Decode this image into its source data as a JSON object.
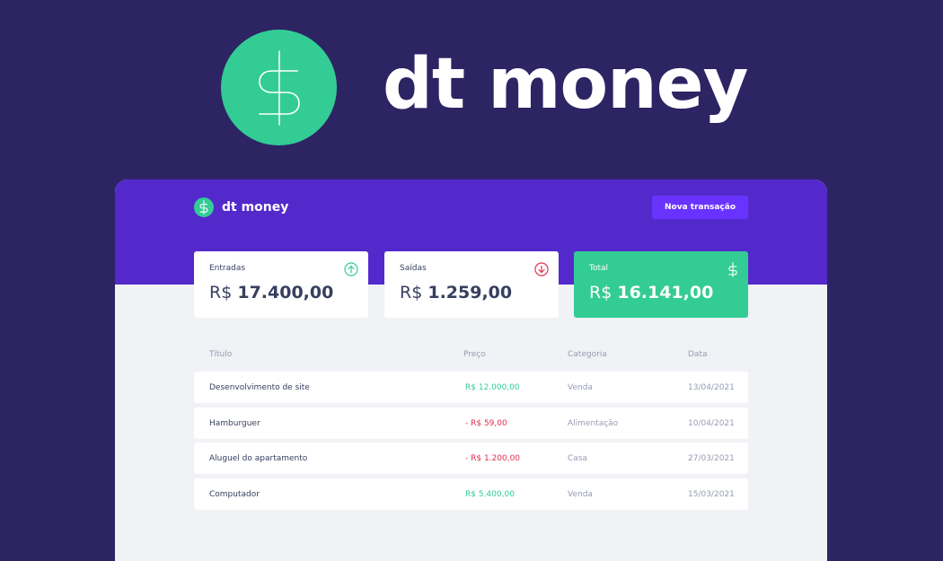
{
  "hero": {
    "title": "dt money"
  },
  "header": {
    "brand": "dt money",
    "new_transaction_label": "Nova transação"
  },
  "summary": {
    "income": {
      "label": "Entradas",
      "currency": "R$",
      "amount": "17.400,00",
      "icon": "arrow-up-circle-icon"
    },
    "outcome": {
      "label": "Saídas",
      "currency": "R$",
      "amount": "1.259,00",
      "icon": "arrow-down-circle-icon"
    },
    "total": {
      "label": "Total",
      "currency": "R$",
      "amount": "16.141,00",
      "icon": "dollar-icon"
    }
  },
  "table": {
    "headers": {
      "title": "Título",
      "price": "Preço",
      "category": "Categoria",
      "date": "Data"
    },
    "rows": [
      {
        "title": "Desenvolvimento de site",
        "price": "R$ 12.000,00",
        "type": "deposit",
        "category": "Venda",
        "date": "13/04/2021"
      },
      {
        "title": "Hamburguer",
        "price": "- R$ 59,00",
        "type": "withdraw",
        "category": "Alimentação",
        "date": "10/04/2021"
      },
      {
        "title": "Aluguel do apartamento",
        "price": "- R$ 1.200,00",
        "type": "withdraw",
        "category": "Casa",
        "date": "27/03/2021"
      },
      {
        "title": "Computador",
        "price": "R$ 5.400,00",
        "type": "deposit",
        "category": "Venda",
        "date": "15/03/2021"
      }
    ]
  },
  "colors": {
    "background": "#2d2463",
    "header": "#5429cc",
    "accent": "#33cc95",
    "button": "#6933ff",
    "danger": "#e52e4d"
  }
}
